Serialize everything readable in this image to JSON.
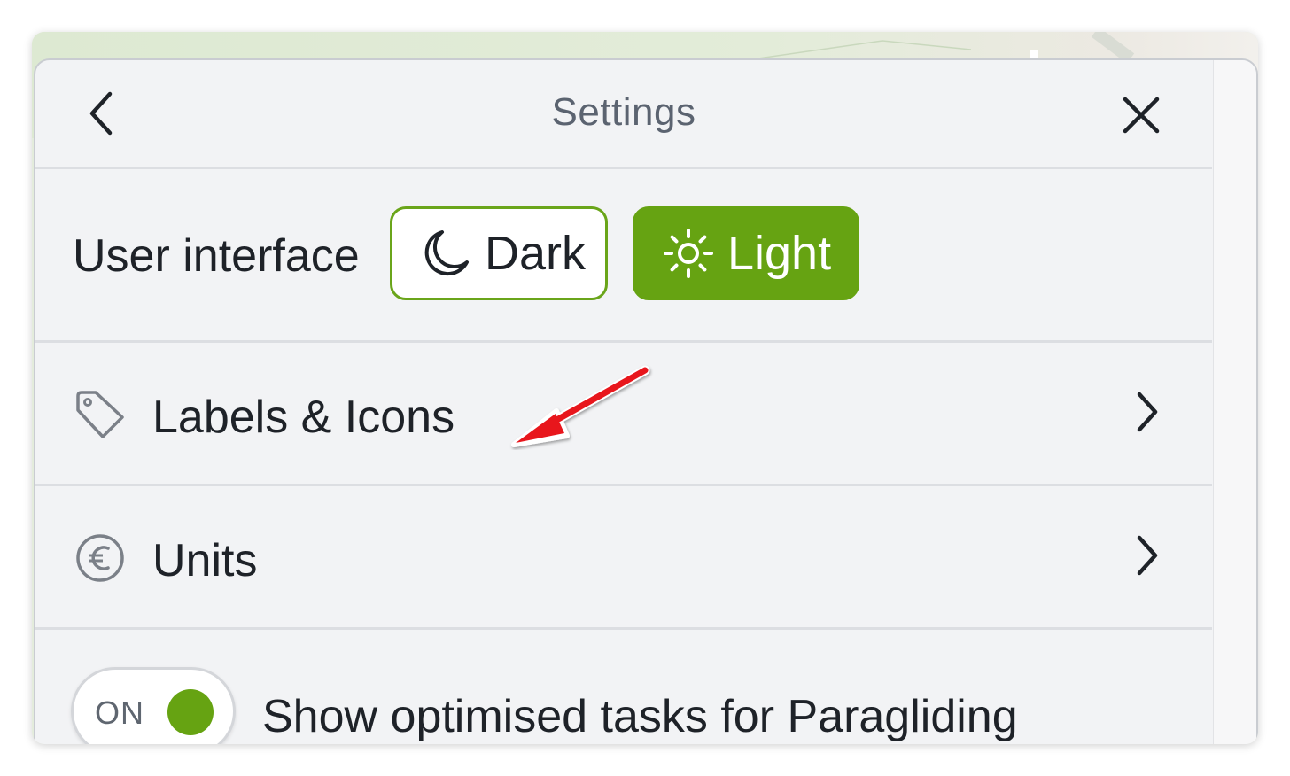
{
  "header": {
    "title": "Settings"
  },
  "user_interface": {
    "label": "User interface",
    "options": [
      {
        "label": "Dark",
        "icon": "moon-icon",
        "selected": false
      },
      {
        "label": "Light",
        "icon": "sun-icon",
        "selected": true
      }
    ]
  },
  "menu": {
    "labels_icons": {
      "label": "Labels & Icons",
      "icon": "tag-icon"
    },
    "units": {
      "label": "Units",
      "icon": "euro-icon"
    }
  },
  "toggle": {
    "state_text": "ON",
    "checked": true,
    "label": "Show optimised tasks for Paragliding"
  },
  "colors": {
    "accent": "#66a312",
    "panel_bg": "#f2f3f5",
    "annotation_arrow": "#e8141b"
  }
}
